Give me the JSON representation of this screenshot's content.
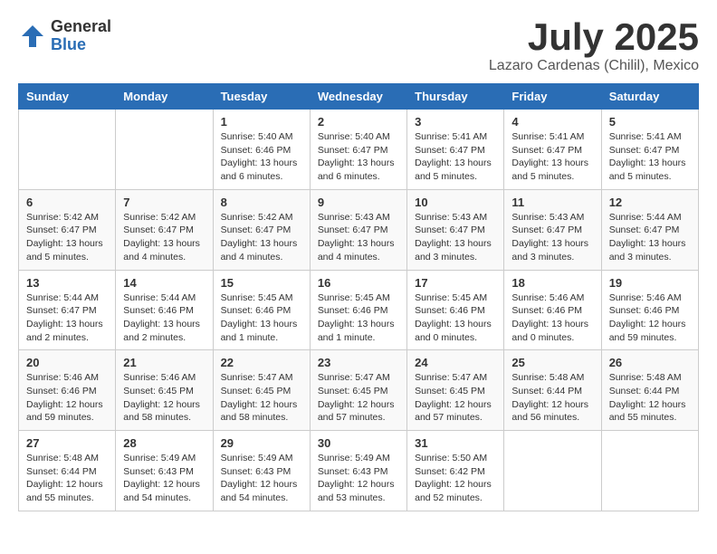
{
  "logo": {
    "general": "General",
    "blue": "Blue"
  },
  "header": {
    "month": "July 2025",
    "location": "Lazaro Cardenas (Chilil), Mexico"
  },
  "weekdays": [
    "Sunday",
    "Monday",
    "Tuesday",
    "Wednesday",
    "Thursday",
    "Friday",
    "Saturday"
  ],
  "weeks": [
    [
      {
        "day": "",
        "sunrise": "",
        "sunset": "",
        "daylight": ""
      },
      {
        "day": "",
        "sunrise": "",
        "sunset": "",
        "daylight": ""
      },
      {
        "day": "1",
        "sunrise": "Sunrise: 5:40 AM",
        "sunset": "Sunset: 6:46 PM",
        "daylight": "Daylight: 13 hours and 6 minutes."
      },
      {
        "day": "2",
        "sunrise": "Sunrise: 5:40 AM",
        "sunset": "Sunset: 6:47 PM",
        "daylight": "Daylight: 13 hours and 6 minutes."
      },
      {
        "day": "3",
        "sunrise": "Sunrise: 5:41 AM",
        "sunset": "Sunset: 6:47 PM",
        "daylight": "Daylight: 13 hours and 5 minutes."
      },
      {
        "day": "4",
        "sunrise": "Sunrise: 5:41 AM",
        "sunset": "Sunset: 6:47 PM",
        "daylight": "Daylight: 13 hours and 5 minutes."
      },
      {
        "day": "5",
        "sunrise": "Sunrise: 5:41 AM",
        "sunset": "Sunset: 6:47 PM",
        "daylight": "Daylight: 13 hours and 5 minutes."
      }
    ],
    [
      {
        "day": "6",
        "sunrise": "Sunrise: 5:42 AM",
        "sunset": "Sunset: 6:47 PM",
        "daylight": "Daylight: 13 hours and 5 minutes."
      },
      {
        "day": "7",
        "sunrise": "Sunrise: 5:42 AM",
        "sunset": "Sunset: 6:47 PM",
        "daylight": "Daylight: 13 hours and 4 minutes."
      },
      {
        "day": "8",
        "sunrise": "Sunrise: 5:42 AM",
        "sunset": "Sunset: 6:47 PM",
        "daylight": "Daylight: 13 hours and 4 minutes."
      },
      {
        "day": "9",
        "sunrise": "Sunrise: 5:43 AM",
        "sunset": "Sunset: 6:47 PM",
        "daylight": "Daylight: 13 hours and 4 minutes."
      },
      {
        "day": "10",
        "sunrise": "Sunrise: 5:43 AM",
        "sunset": "Sunset: 6:47 PM",
        "daylight": "Daylight: 13 hours and 3 minutes."
      },
      {
        "day": "11",
        "sunrise": "Sunrise: 5:43 AM",
        "sunset": "Sunset: 6:47 PM",
        "daylight": "Daylight: 13 hours and 3 minutes."
      },
      {
        "day": "12",
        "sunrise": "Sunrise: 5:44 AM",
        "sunset": "Sunset: 6:47 PM",
        "daylight": "Daylight: 13 hours and 3 minutes."
      }
    ],
    [
      {
        "day": "13",
        "sunrise": "Sunrise: 5:44 AM",
        "sunset": "Sunset: 6:47 PM",
        "daylight": "Daylight: 13 hours and 2 minutes."
      },
      {
        "day": "14",
        "sunrise": "Sunrise: 5:44 AM",
        "sunset": "Sunset: 6:46 PM",
        "daylight": "Daylight: 13 hours and 2 minutes."
      },
      {
        "day": "15",
        "sunrise": "Sunrise: 5:45 AM",
        "sunset": "Sunset: 6:46 PM",
        "daylight": "Daylight: 13 hours and 1 minute."
      },
      {
        "day": "16",
        "sunrise": "Sunrise: 5:45 AM",
        "sunset": "Sunset: 6:46 PM",
        "daylight": "Daylight: 13 hours and 1 minute."
      },
      {
        "day": "17",
        "sunrise": "Sunrise: 5:45 AM",
        "sunset": "Sunset: 6:46 PM",
        "daylight": "Daylight: 13 hours and 0 minutes."
      },
      {
        "day": "18",
        "sunrise": "Sunrise: 5:46 AM",
        "sunset": "Sunset: 6:46 PM",
        "daylight": "Daylight: 13 hours and 0 minutes."
      },
      {
        "day": "19",
        "sunrise": "Sunrise: 5:46 AM",
        "sunset": "Sunset: 6:46 PM",
        "daylight": "Daylight: 12 hours and 59 minutes."
      }
    ],
    [
      {
        "day": "20",
        "sunrise": "Sunrise: 5:46 AM",
        "sunset": "Sunset: 6:46 PM",
        "daylight": "Daylight: 12 hours and 59 minutes."
      },
      {
        "day": "21",
        "sunrise": "Sunrise: 5:46 AM",
        "sunset": "Sunset: 6:45 PM",
        "daylight": "Daylight: 12 hours and 58 minutes."
      },
      {
        "day": "22",
        "sunrise": "Sunrise: 5:47 AM",
        "sunset": "Sunset: 6:45 PM",
        "daylight": "Daylight: 12 hours and 58 minutes."
      },
      {
        "day": "23",
        "sunrise": "Sunrise: 5:47 AM",
        "sunset": "Sunset: 6:45 PM",
        "daylight": "Daylight: 12 hours and 57 minutes."
      },
      {
        "day": "24",
        "sunrise": "Sunrise: 5:47 AM",
        "sunset": "Sunset: 6:45 PM",
        "daylight": "Daylight: 12 hours and 57 minutes."
      },
      {
        "day": "25",
        "sunrise": "Sunrise: 5:48 AM",
        "sunset": "Sunset: 6:44 PM",
        "daylight": "Daylight: 12 hours and 56 minutes."
      },
      {
        "day": "26",
        "sunrise": "Sunrise: 5:48 AM",
        "sunset": "Sunset: 6:44 PM",
        "daylight": "Daylight: 12 hours and 55 minutes."
      }
    ],
    [
      {
        "day": "27",
        "sunrise": "Sunrise: 5:48 AM",
        "sunset": "Sunset: 6:44 PM",
        "daylight": "Daylight: 12 hours and 55 minutes."
      },
      {
        "day": "28",
        "sunrise": "Sunrise: 5:49 AM",
        "sunset": "Sunset: 6:43 PM",
        "daylight": "Daylight: 12 hours and 54 minutes."
      },
      {
        "day": "29",
        "sunrise": "Sunrise: 5:49 AM",
        "sunset": "Sunset: 6:43 PM",
        "daylight": "Daylight: 12 hours and 54 minutes."
      },
      {
        "day": "30",
        "sunrise": "Sunrise: 5:49 AM",
        "sunset": "Sunset: 6:43 PM",
        "daylight": "Daylight: 12 hours and 53 minutes."
      },
      {
        "day": "31",
        "sunrise": "Sunrise: 5:50 AM",
        "sunset": "Sunset: 6:42 PM",
        "daylight": "Daylight: 12 hours and 52 minutes."
      },
      {
        "day": "",
        "sunrise": "",
        "sunset": "",
        "daylight": ""
      },
      {
        "day": "",
        "sunrise": "",
        "sunset": "",
        "daylight": ""
      }
    ]
  ]
}
